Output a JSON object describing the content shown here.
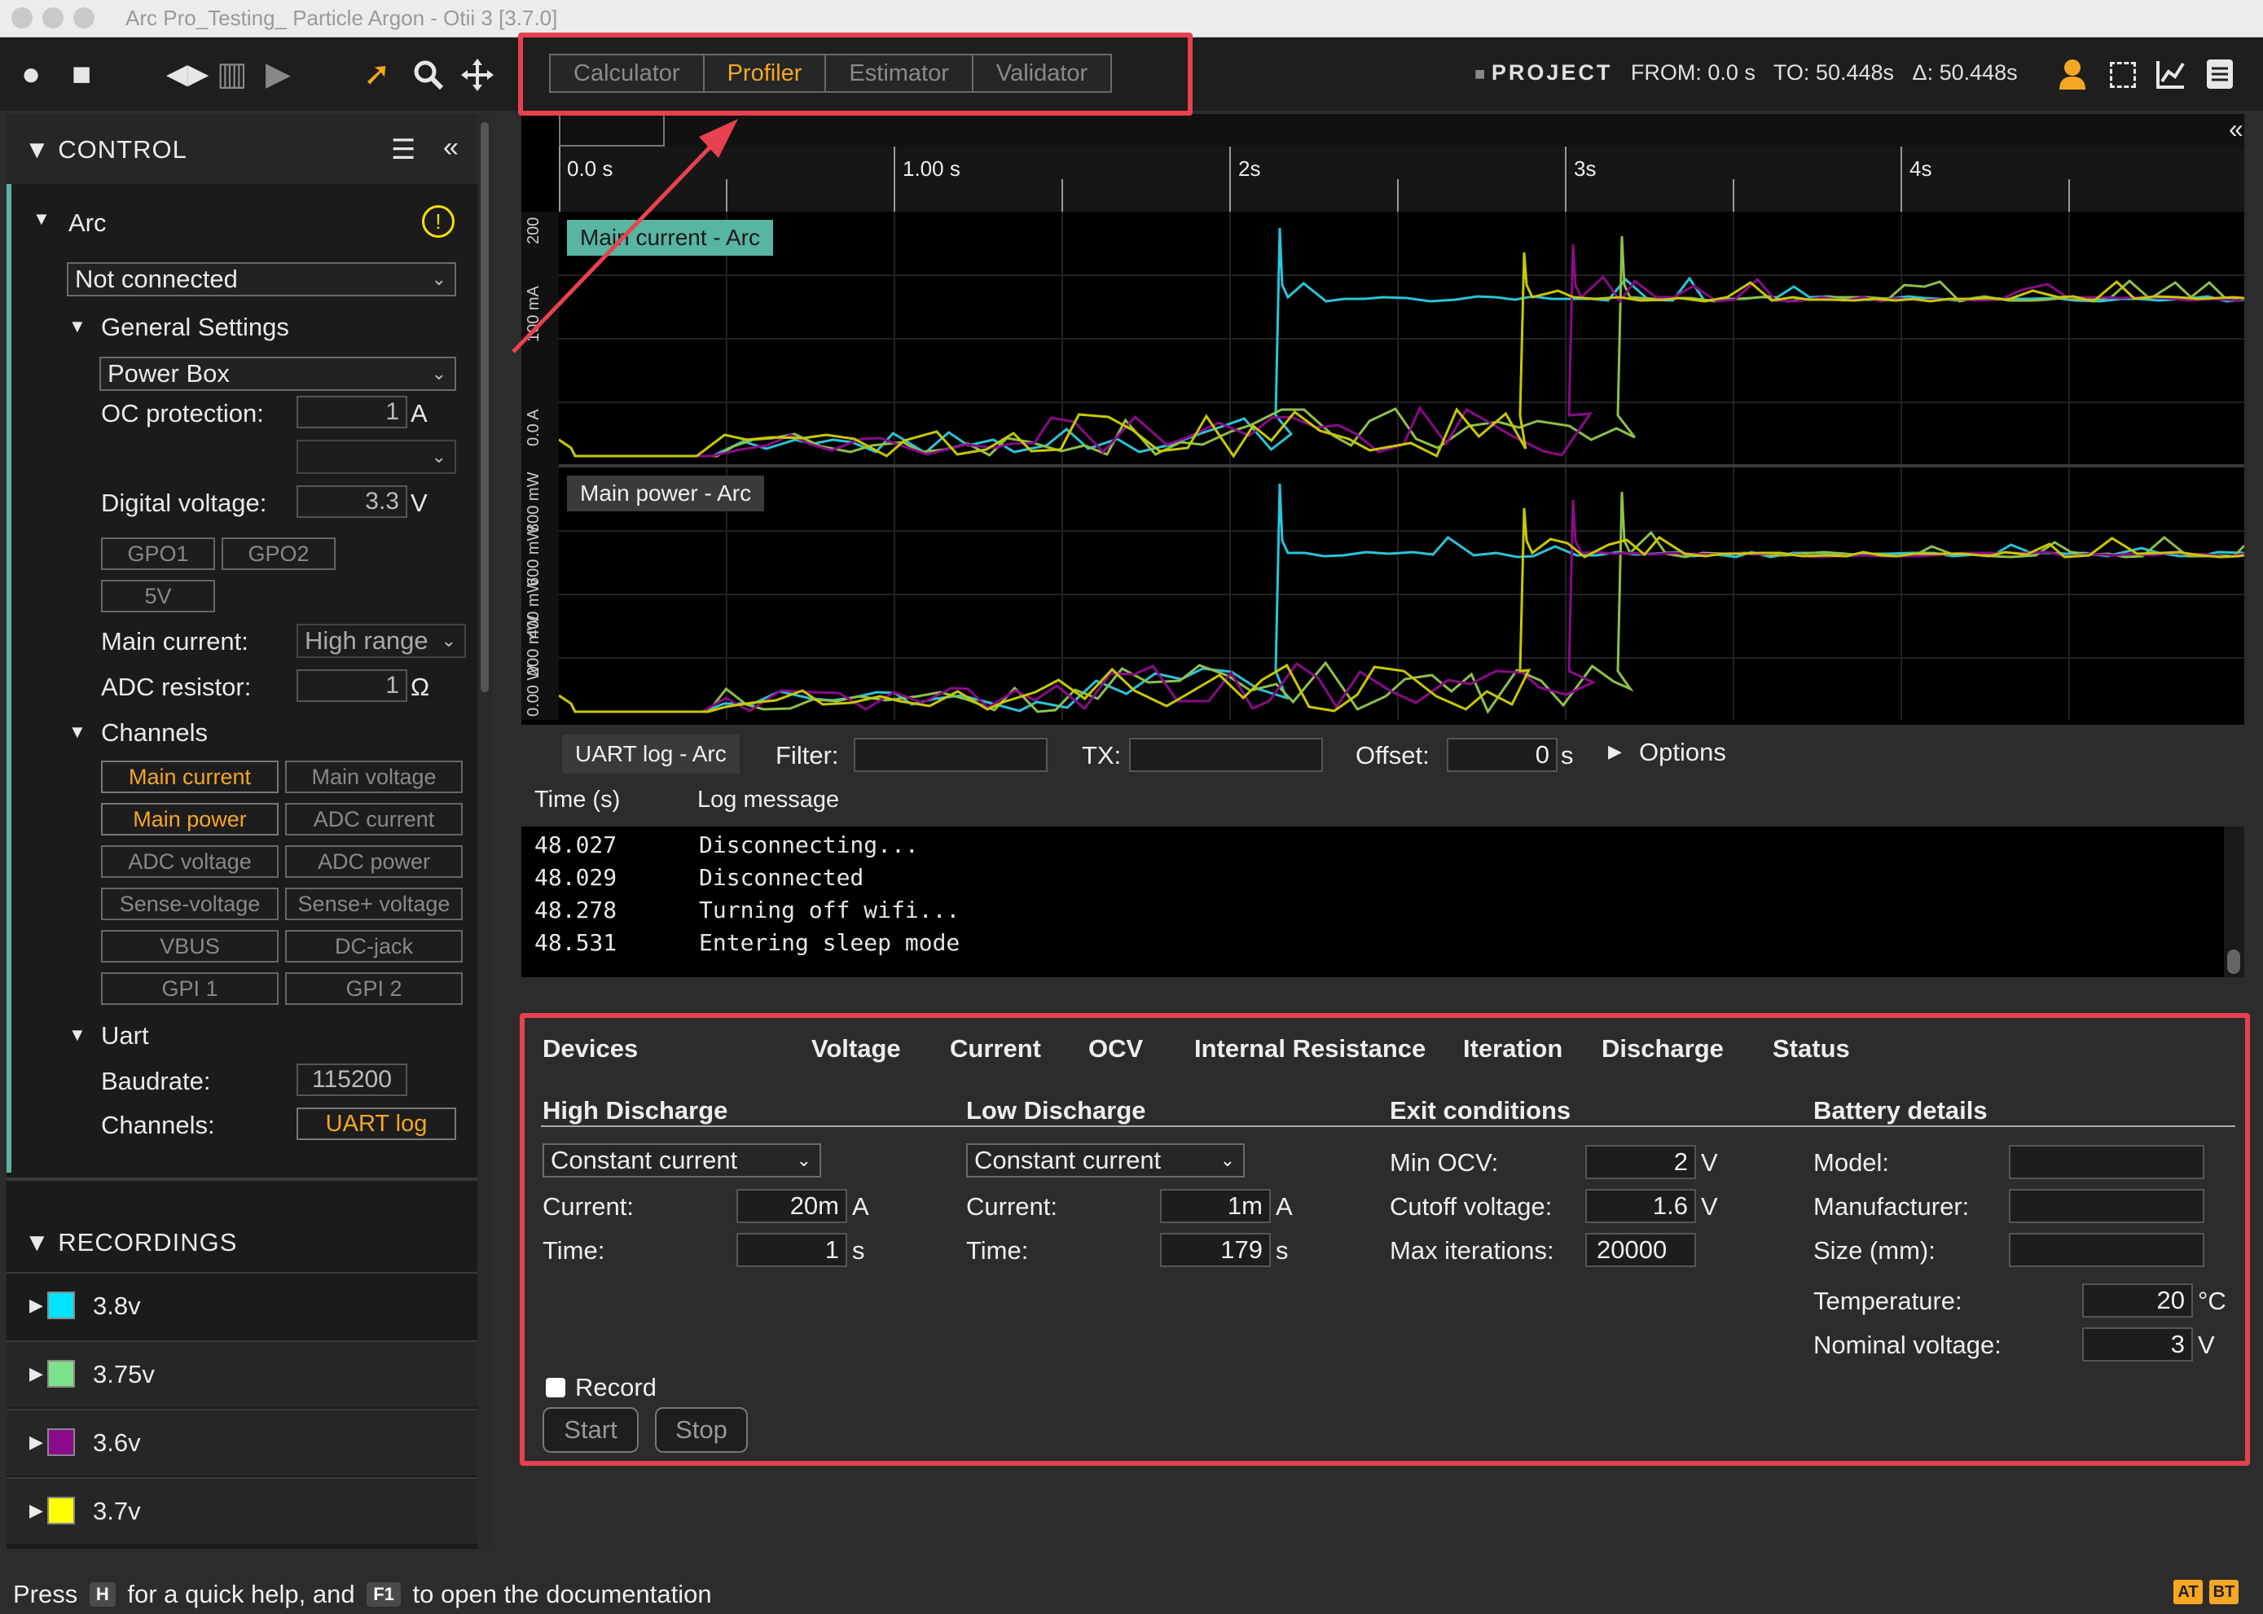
{
  "window": {
    "title": "Arc Pro_Testing_ Particle Argon - Otii 3 [3.7.0]"
  },
  "toolbar": {
    "tabs": [
      {
        "label": "Calculator",
        "active": false
      },
      {
        "label": "Profiler",
        "active": true
      },
      {
        "label": "Estimator",
        "active": false
      },
      {
        "label": "Validator",
        "active": false
      }
    ],
    "project_label": "PROJECT",
    "from": "FROM: 0.0 s",
    "to": "TO: 50.448s",
    "delta": "Δ: 50.448s"
  },
  "control": {
    "title": "CONTROL",
    "device": {
      "name": "Arc",
      "connection": "Not connected",
      "warning_icon": "!"
    },
    "general_settings": {
      "title": "General Settings",
      "source": "Power Box",
      "oc_label": "OC protection:",
      "oc_value": "1",
      "oc_unit": "A",
      "digital_voltage_label": "Digital voltage:",
      "digital_voltage_value": "3.3",
      "digital_voltage_unit": "V",
      "gpo": [
        "GPO1",
        "GPO2",
        "5V"
      ],
      "main_current_label": "Main current:",
      "main_current_range": "High range",
      "adc_resistor_label": "ADC resistor:",
      "adc_resistor_value": "1",
      "adc_resistor_unit": "Ω"
    },
    "channels": {
      "title": "Channels",
      "items": [
        {
          "label": "Main current",
          "on": true
        },
        {
          "label": "Main voltage",
          "on": false
        },
        {
          "label": "Main power",
          "on": true
        },
        {
          "label": "ADC current",
          "on": false
        },
        {
          "label": "ADC voltage",
          "on": false
        },
        {
          "label": "ADC power",
          "on": false
        },
        {
          "label": "Sense-voltage",
          "on": false
        },
        {
          "label": "Sense+ voltage",
          "on": false
        },
        {
          "label": "VBUS",
          "on": false
        },
        {
          "label": "DC-jack",
          "on": false
        },
        {
          "label": "GPI 1",
          "on": false
        },
        {
          "label": "GPI 2",
          "on": false
        }
      ]
    },
    "uart": {
      "title": "Uart",
      "baudrate_label": "Baudrate:",
      "baudrate_value": "115200",
      "channels_label": "Channels:",
      "channels_value": "UART log"
    }
  },
  "recordings": {
    "title": "RECORDINGS",
    "items": [
      {
        "name": "3.8v",
        "color": "#00e5ff"
      },
      {
        "name": "3.75v",
        "color": "#7de38a"
      },
      {
        "name": "3.6v",
        "color": "#8a0a8a"
      },
      {
        "name": "3.7v",
        "color": "#ffff00"
      }
    ]
  },
  "timeline": {
    "ticks": [
      "0.0 s",
      "1.00 s",
      "2s",
      "3s",
      "4s"
    ]
  },
  "charts": {
    "current": {
      "label": "Main current - Arc",
      "y_ticks": [
        "200",
        "100 mA",
        "0.0 A"
      ]
    },
    "power": {
      "label": "Main power - Arc",
      "y_ticks": [
        "800 mW",
        "600 mW",
        "400 mW",
        "200 mW",
        "0.00 W"
      ]
    }
  },
  "uart_log": {
    "title": "UART log - Arc",
    "filter_label": "Filter:",
    "tx_label": "TX:",
    "offset_label": "Offset:",
    "offset_value": "0",
    "offset_unit": "s",
    "options_label": "Options",
    "col_time": "Time (s)",
    "col_msg": "Log message",
    "rows": [
      {
        "t": "48.027",
        "msg": "Disconnecting..."
      },
      {
        "t": "48.029",
        "msg": "Disconnected"
      },
      {
        "t": "48.278",
        "msg": "Turning off wifi..."
      },
      {
        "t": "48.531",
        "msg": "Entering sleep mode"
      }
    ]
  },
  "profiler": {
    "columns": [
      "Devices",
      "Voltage",
      "Current",
      "OCV",
      "Internal Resistance",
      "Iteration",
      "Discharge",
      "Status"
    ],
    "high": {
      "title": "High Discharge",
      "mode": "Constant current",
      "current_label": "Current:",
      "current": "20m",
      "current_unit": "A",
      "time_label": "Time:",
      "time": "1",
      "time_unit": "s"
    },
    "low": {
      "title": "Low Discharge",
      "mode": "Constant current",
      "current_label": "Current:",
      "current": "1m",
      "current_unit": "A",
      "time_label": "Time:",
      "time": "179",
      "time_unit": "s"
    },
    "exit": {
      "title": "Exit conditions",
      "min_ocv_label": "Min OCV:",
      "min_ocv": "2",
      "min_ocv_unit": "V",
      "cutoff_label": "Cutoff voltage:",
      "cutoff": "1.6",
      "cutoff_unit": "V",
      "max_iter_label": "Max iterations:",
      "max_iter": "20000"
    },
    "battery": {
      "title": "Battery details",
      "model_label": "Model:",
      "manufacturer_label": "Manufacturer:",
      "size_label": "Size (mm):",
      "temp_label": "Temperature:",
      "temp": "20",
      "temp_unit": "°C",
      "nominal_label": "Nominal voltage:",
      "nominal": "3",
      "nominal_unit": "V"
    },
    "record_label": "Record",
    "start_label": "Start",
    "stop_label": "Stop"
  },
  "footer": {
    "press": "Press",
    "key_h": "H",
    "mid": "for a quick help, and",
    "key_f1": "F1",
    "end": "to open the documentation",
    "badge_at": "AT",
    "badge_bt": "BT"
  },
  "colors": {
    "accent": "#f5a623",
    "highlight": "#e8414f",
    "cyan": "#2bc4d8",
    "green": "#8fbf4a",
    "purple": "#8a0a8a",
    "yellow": "#c8c800"
  }
}
